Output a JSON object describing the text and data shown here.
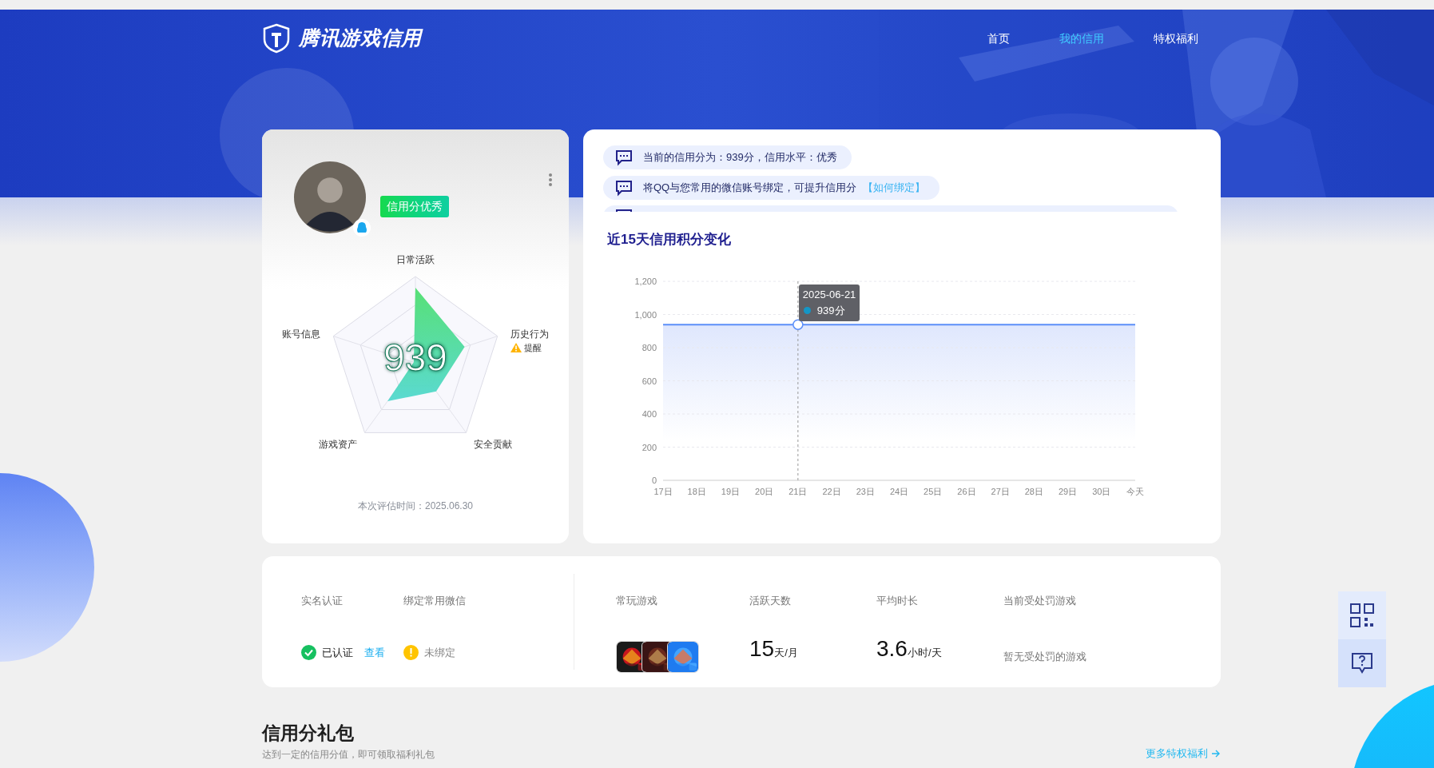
{
  "header": {
    "logo": "腾讯游戏信用",
    "nav": [
      {
        "label": "首页",
        "selected": false
      },
      {
        "label": "我的信用",
        "selected": true
      },
      {
        "label": "特权福利",
        "selected": false
      }
    ]
  },
  "profile": {
    "badge": "信用分优秀",
    "score": "939",
    "radar_labels": [
      "日常活跃",
      "历史行为",
      "安全贡献",
      "游戏资产",
      "账号信息"
    ],
    "history_alert": "提醒",
    "eval_time": "本次评估时间：2025.06.30"
  },
  "messages": [
    {
      "text": "当前的信用分为：939分，信用水平：优秀"
    },
    {
      "text": "将QQ与您常用的微信账号绑定，可提升信用分",
      "link": "【如何绑定】"
    }
  ],
  "chart": {
    "title": "近15天信用积分变化",
    "tooltip": {
      "date": "2025-06-21",
      "value": "939分"
    },
    "chart_data": {
      "type": "area",
      "categories": [
        "17日",
        "18日",
        "19日",
        "20日",
        "21日",
        "22日",
        "23日",
        "24日",
        "25日",
        "26日",
        "27日",
        "28日",
        "29日",
        "30日",
        "今天"
      ],
      "series": [
        {
          "color": "#5b8ff9",
          "values": [
            939,
            939,
            939,
            939,
            939,
            939,
            939,
            939,
            939,
            939,
            939,
            939,
            939,
            939,
            939
          ]
        }
      ],
      "grid": true,
      "ref_lines": [
        {
          "axis": "x",
          "value": "21日"
        }
      ],
      "ylim": [
        0,
        1200
      ],
      "yticks": [
        0,
        200,
        400,
        600,
        800,
        {
          "value": 1000,
          "label": "1,000"
        },
        {
          "value": 1200,
          "label": "1,200"
        }
      ]
    }
  },
  "account": [
    {
      "label": "实名认证",
      "status": "已认证",
      "ok": true,
      "link": "查看"
    },
    {
      "label": "绑定常用微信",
      "status": "未绑定",
      "ok": false
    }
  ],
  "games": {
    "label": "常玩游戏"
  },
  "stats": [
    {
      "label": "活跃天数",
      "value": "15",
      "unit": "天/月"
    },
    {
      "label": "平均时长",
      "value": "3.6",
      "unit": "小时/天"
    }
  ],
  "penalty": {
    "label": "当前受处罚游戏",
    "text": "暂无受处罚的游戏"
  },
  "gift": {
    "title": "信用分礼包",
    "subtitle": "达到一定的信用分值，即可领取福利礼包",
    "more": "更多特权福利"
  }
}
